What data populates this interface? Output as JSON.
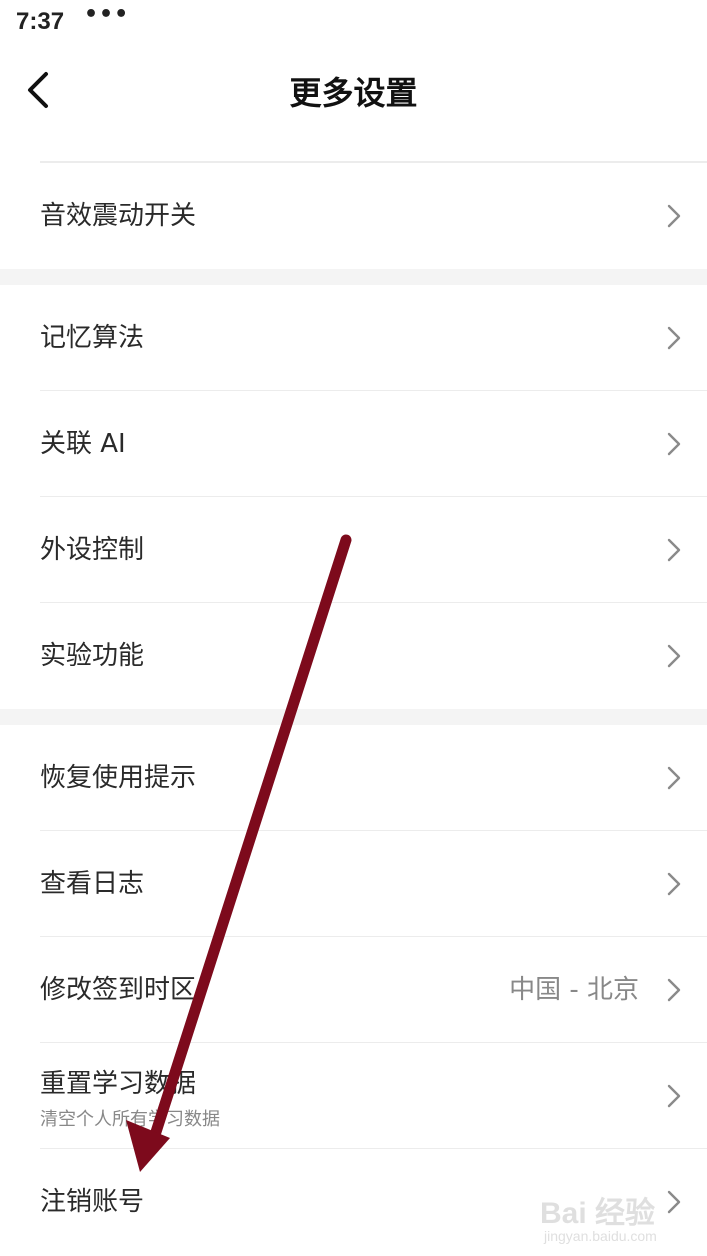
{
  "status_bar": {
    "time": "7:37",
    "overflow": "•••"
  },
  "header": {
    "title": "更多设置",
    "back_icon": "chevron-left-icon"
  },
  "sections": [
    {
      "items": [
        {
          "label": "音效震动开关"
        }
      ]
    },
    {
      "items": [
        {
          "label": "记忆算法"
        },
        {
          "label": "关联 AI"
        },
        {
          "label": "外设控制"
        },
        {
          "label": "实验功能"
        }
      ]
    },
    {
      "items": [
        {
          "label": "恢复使用提示"
        },
        {
          "label": "查看日志"
        },
        {
          "label": "修改签到时区",
          "value": "中国 - 北京"
        },
        {
          "label": "重置学习数据",
          "sublabel": "清空个人所有学习数据"
        },
        {
          "label": "注销账号"
        }
      ]
    }
  ],
  "colors": {
    "annotation_arrow": "#7d0a1c",
    "divider": "#ececec",
    "section_gap": "#f4f4f4",
    "chevron": "#8a8a8a"
  },
  "watermark": {
    "text": "Bai 经验",
    "sub": "jingyan.baidu.com"
  }
}
